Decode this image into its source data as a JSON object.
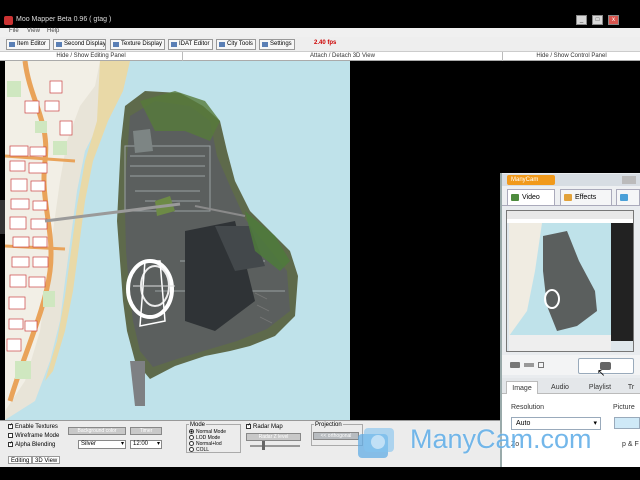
{
  "window": {
    "title": "Moo Mapper Beta 0.96 ( gtag )",
    "controls": [
      "_",
      "□",
      "x"
    ]
  },
  "menu": [
    "File",
    "View",
    "Help"
  ],
  "toolbar": {
    "buttons": [
      "Item Editor",
      "Second Display",
      "Texture Display",
      "IDAT Editor",
      "City Tools",
      "Settings"
    ],
    "fps": "2.40 fps"
  },
  "panel_bar": {
    "left": "Hide / Show Editing Panel",
    "center": "Attach / Detach 3D View",
    "right": "Hide / Show Control Panel"
  },
  "editing_panel": {
    "checkboxes": [
      {
        "label": "Enable Textures",
        "checked": true
      },
      {
        "label": "Wireframe Mode",
        "checked": false
      },
      {
        "label": "Alpha Blending",
        "checked": true
      }
    ],
    "background_color": {
      "label": "Background color",
      "value": "Silver"
    },
    "timer": {
      "label": "Timer",
      "value": "12:00"
    },
    "mode": {
      "title": "Mode",
      "options": [
        "Normal Mode",
        "LOD Mode",
        "Normal+lod",
        "COLL"
      ],
      "selected": "Normal Mode"
    },
    "radar_map": {
      "label": "Radar Map",
      "checked": true,
      "level_label": "Radar Z level"
    },
    "projection": {
      "title": "Projection",
      "value": "<< orthogonal"
    },
    "tabs": [
      "Editing",
      "3D View"
    ]
  },
  "manycam": {
    "brand": "ManyCam",
    "tabs": [
      "Video",
      "Effects"
    ],
    "subtabs": [
      "Image",
      "Audio",
      "Playlist",
      "Tr"
    ],
    "resolution_label": "Resolution",
    "resolution_value": "Auto",
    "picture_label": "Picture",
    "partial_labels": [
      "Zo",
      "p & F"
    ],
    "watermark": "ManyCam.com"
  },
  "colors": {
    "accent_orange": "#f19a1c",
    "water": "#b8dfe8",
    "fps_red": "#cc0000"
  }
}
